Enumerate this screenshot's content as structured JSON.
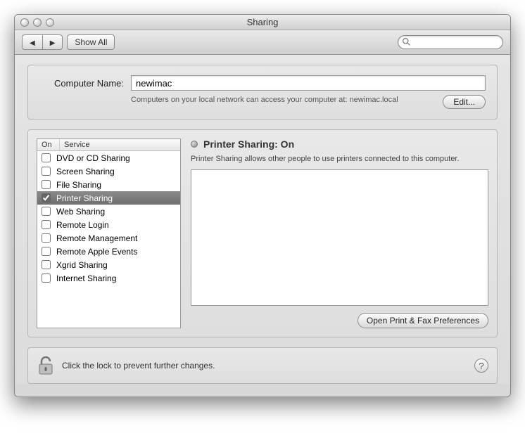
{
  "window": {
    "title": "Sharing"
  },
  "toolbar": {
    "show_all": "Show All",
    "search_placeholder": ""
  },
  "computer_name": {
    "label": "Computer Name:",
    "value": "newimac",
    "hint": "Computers on your local network can access your computer at: newimac.local",
    "edit_btn": "Edit..."
  },
  "services": {
    "columns": {
      "on": "On",
      "service": "Service"
    },
    "items": [
      {
        "label": "DVD or CD Sharing",
        "on": false,
        "selected": false
      },
      {
        "label": "Screen Sharing",
        "on": false,
        "selected": false
      },
      {
        "label": "File Sharing",
        "on": false,
        "selected": false
      },
      {
        "label": "Printer Sharing",
        "on": true,
        "selected": true
      },
      {
        "label": "Web Sharing",
        "on": false,
        "selected": false
      },
      {
        "label": "Remote Login",
        "on": false,
        "selected": false
      },
      {
        "label": "Remote Management",
        "on": false,
        "selected": false
      },
      {
        "label": "Remote Apple Events",
        "on": false,
        "selected": false
      },
      {
        "label": "Xgrid Sharing",
        "on": false,
        "selected": false
      },
      {
        "label": "Internet Sharing",
        "on": false,
        "selected": false
      }
    ]
  },
  "detail": {
    "title": "Printer Sharing: On",
    "desc": "Printer Sharing allows other people to use printers connected to this computer.",
    "open_btn": "Open Print & Fax Preferences"
  },
  "footer": {
    "lock_text": "Click the lock to prevent further changes."
  }
}
